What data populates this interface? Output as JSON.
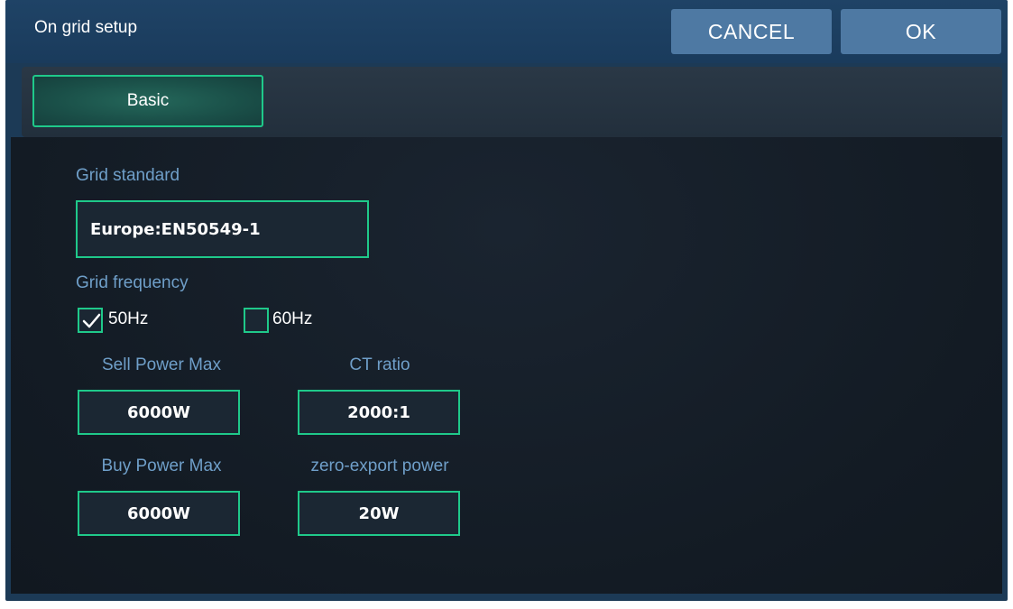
{
  "header": {
    "title": "On grid setup",
    "cancel_label": "CANCEL",
    "ok_label": "OK"
  },
  "tabs": [
    {
      "label": "Basic",
      "active": true
    }
  ],
  "form": {
    "grid_standard": {
      "label": "Grid standard",
      "value": "Europe:EN50549-1"
    },
    "grid_frequency": {
      "label": "Grid frequency",
      "options": [
        {
          "label": "50Hz",
          "checked": true
        },
        {
          "label": "60Hz",
          "checked": false
        }
      ]
    },
    "sell_power_max": {
      "label": "Sell Power Max",
      "value": "6000W"
    },
    "ct_ratio": {
      "label": "CT ratio",
      "value": "2000:1"
    },
    "buy_power_max": {
      "label": "Buy Power Max",
      "value": "6000W"
    },
    "zero_export_power": {
      "label": "zero-export power",
      "value": "20W"
    }
  },
  "colors": {
    "accent": "#1fc98a",
    "label": "#6f9fc9",
    "titlebar": "#1c3a56",
    "button": "#4e79a3"
  }
}
